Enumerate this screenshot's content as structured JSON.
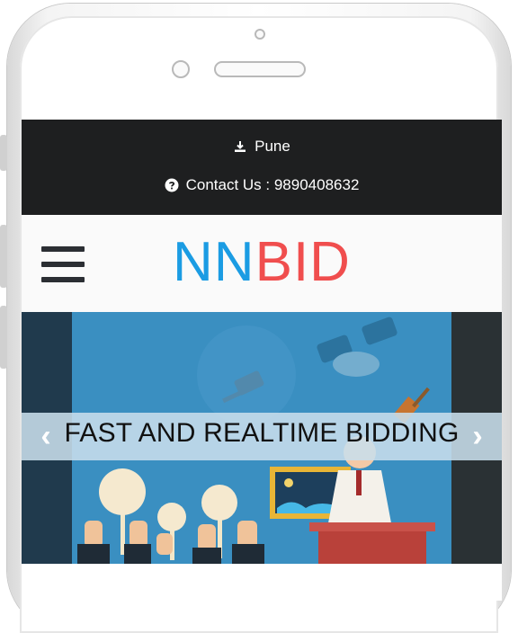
{
  "topbar": {
    "location": "Pune",
    "contact": "Contact Us : 9890408632"
  },
  "header": {
    "logo_part1": "NN",
    "logo_part2": "BID"
  },
  "hero": {
    "caption": "FAST AND REALTIME BIDDING",
    "prev_label": "‹",
    "next_label": "›"
  },
  "colors": {
    "topbar_bg": "#1e1f20",
    "logo_blue": "#1b9ce3",
    "logo_red": "#f04e4e",
    "hero_bg": "#3a8fc1"
  }
}
